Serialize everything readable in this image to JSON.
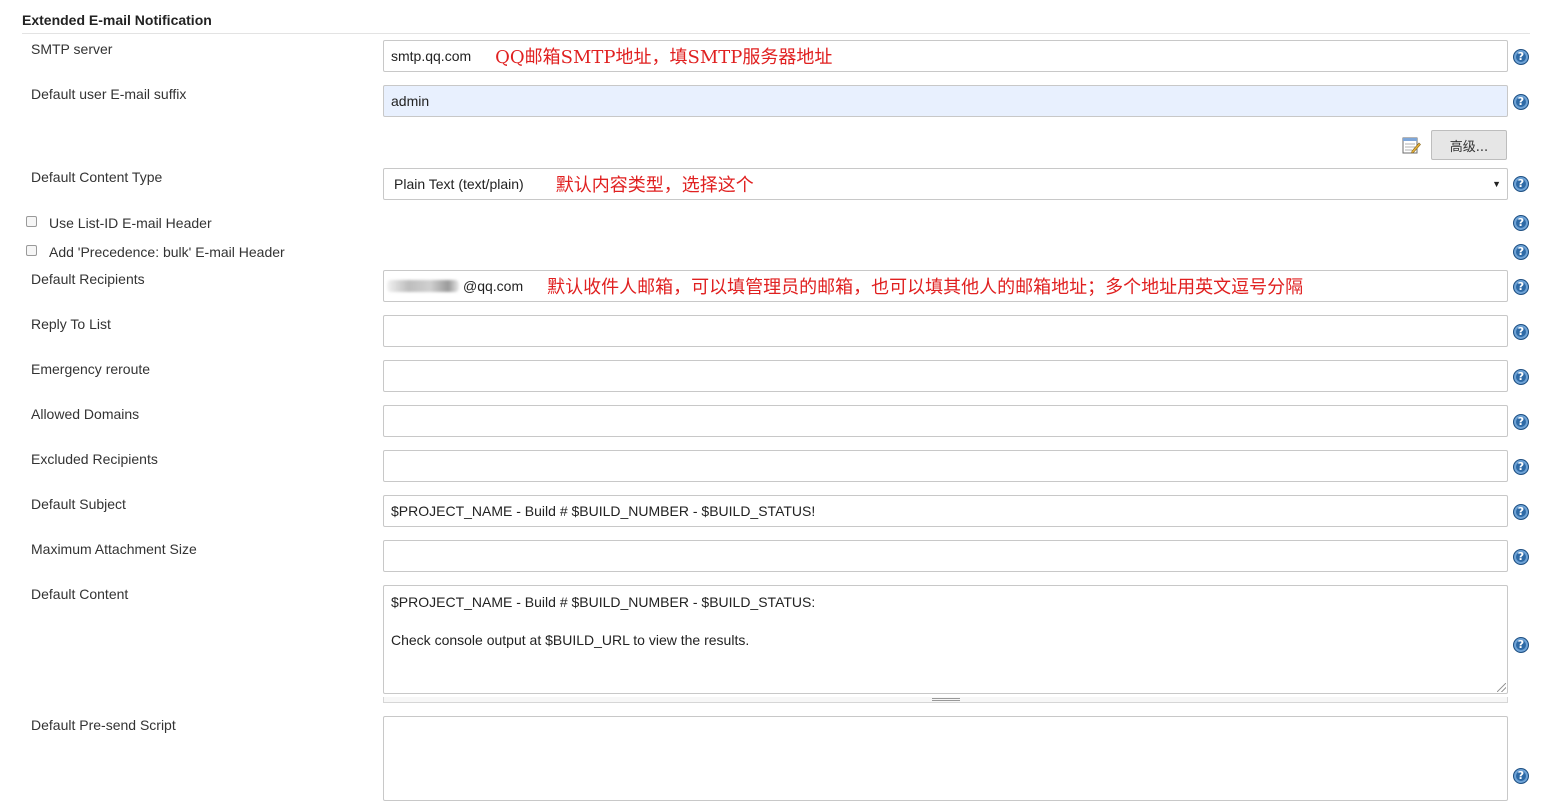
{
  "section": {
    "title": "Extended E-mail Notification"
  },
  "fields": {
    "smtp_server": {
      "label": "SMTP server",
      "value": "smtp.qq.com",
      "annotation": "QQ邮箱SMTP地址，填SMTP服务器地址"
    },
    "default_suffix": {
      "label": "Default user E-mail suffix",
      "value": "admin"
    },
    "advanced_button": "高级...",
    "content_type": {
      "label": "Default Content Type",
      "value": "Plain Text (text/plain)",
      "annotation": "默认内容类型，选择这个"
    },
    "use_list_id": {
      "label": "Use List-ID E-mail Header",
      "checked": false
    },
    "precedence_bulk": {
      "label": "Add 'Precedence: bulk' E-mail Header",
      "checked": false
    },
    "default_recipients": {
      "label": "Default Recipients",
      "value": "@qq.com",
      "annotation": "默认收件人邮箱，可以填管理员的邮箱，也可以填其他人的邮箱地址；多个地址用英文逗号分隔"
    },
    "reply_to_list": {
      "label": "Reply To List",
      "value": ""
    },
    "emergency_reroute": {
      "label": "Emergency reroute",
      "value": ""
    },
    "allowed_domains": {
      "label": "Allowed Domains",
      "value": ""
    },
    "excluded_recipients": {
      "label": "Excluded Recipients",
      "value": ""
    },
    "default_subject": {
      "label": "Default Subject",
      "value": "$PROJECT_NAME - Build # $BUILD_NUMBER - $BUILD_STATUS!"
    },
    "max_attachment_size": {
      "label": "Maximum Attachment Size",
      "value": ""
    },
    "default_content": {
      "label": "Default Content",
      "line1": "$PROJECT_NAME - Build # $BUILD_NUMBER - $BUILD_STATUS:",
      "line2": "",
      "line3": "Check console output at $BUILD_URL to view the results."
    },
    "pre_send_script": {
      "label": "Default Pre-send Script",
      "value": ""
    }
  },
  "help_symbol": "?",
  "select_arrow": "▼",
  "colors": {
    "annotation": "#e02020",
    "help_icon": "#2e6aa6",
    "autofill_bg": "#e8f0fe"
  }
}
